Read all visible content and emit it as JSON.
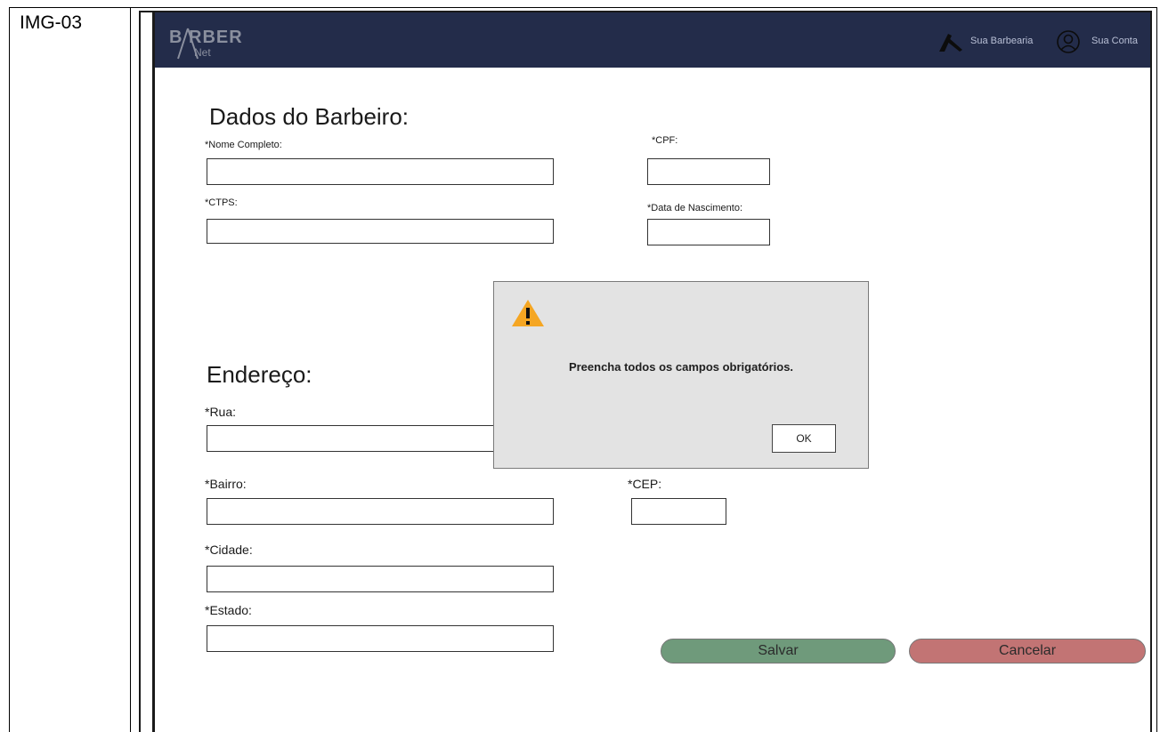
{
  "doc": {
    "row_label": "IMG-03"
  },
  "header": {
    "logo_text": "B RBER",
    "logo_sub": "Net",
    "nav": [
      {
        "label": "Sua Barbearia",
        "icon": "scissors-comb-icon"
      },
      {
        "label": "Sua Conta",
        "icon": "user-circle-icon"
      }
    ]
  },
  "barber": {
    "title": "Dados do Barbeiro:",
    "nome_label": "*Nome Completo:",
    "cpf_label": "*CPF:",
    "ctps_label": "*CTPS:",
    "nascimento_label": "*Data de Nascimento:",
    "nome_value": "",
    "cpf_value": "",
    "ctps_value": "",
    "nascimento_value": ""
  },
  "address": {
    "title": "Endereço:",
    "rua_label": "*Rua:",
    "bairro_label": "*Bairro:",
    "cep_label": "*CEP:",
    "cidade_label": "*Cidade:",
    "estado_label": "*Estado:",
    "rua_value": "",
    "bairro_value": "",
    "cep_value": "",
    "cidade_value": "",
    "estado_value": ""
  },
  "actions": {
    "save": "Salvar",
    "cancel": "Cancelar"
  },
  "dialog": {
    "icon": "warning-icon",
    "message": "Preencha todos os campos obrigatórios.",
    "ok": "OK"
  },
  "colors": {
    "header_bg": "#232c4a",
    "save_bg": "#6f9a7b",
    "cancel_bg": "#c27474",
    "warning": "#f5a623"
  }
}
